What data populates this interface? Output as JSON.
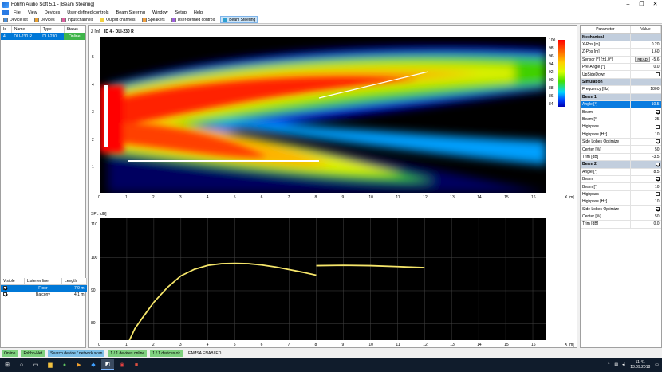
{
  "window": {
    "title": "Fohhn Audio Soft 5.1 - [Beam Steering]",
    "controls": [
      "–",
      "❐",
      "✕"
    ]
  },
  "menu": [
    "File",
    "View",
    "Devices",
    "User-defined controls",
    "Beam Steering",
    "Window",
    "Setup",
    "Help"
  ],
  "tabs": [
    {
      "label": "Device list",
      "color": "#4a8fd8"
    },
    {
      "label": "Devices",
      "color": "#e8a030"
    },
    {
      "label": "Input channels",
      "color": "#e060a0"
    },
    {
      "label": "Output channels",
      "color": "#f0d040"
    },
    {
      "label": "Speakers",
      "color": "#f0a040"
    },
    {
      "label": "User-defined controls",
      "color": "#a060e0"
    },
    {
      "label": "Beam Steering",
      "color": "#30a0d0"
    }
  ],
  "device_table": {
    "headers": [
      "Id",
      "Name",
      "Type",
      "Status"
    ],
    "rows": [
      {
        "id": "4",
        "name": "DLI-230 R",
        "type": "DLI-230",
        "status": "Online"
      }
    ]
  },
  "listener_table": {
    "headers": [
      "Visible",
      "Listener line",
      "Length"
    ],
    "rows": [
      {
        "visible": true,
        "name": "Floor",
        "length": "7.9 m"
      },
      {
        "visible": true,
        "name": "Balcony",
        "length": "4.1 m"
      }
    ]
  },
  "top_plot": {
    "ylabel": "Z [m]",
    "device_label": "ID 4 - DLI-230 R",
    "xlabel": "X [m]",
    "xticks": [
      "0",
      "1",
      "2",
      "3",
      "4",
      "5",
      "6",
      "7",
      "8",
      "9",
      "10",
      "11",
      "12",
      "13",
      "14",
      "15",
      "16"
    ],
    "yticks": [
      "5",
      "4",
      "3",
      "2",
      "1"
    ],
    "colorbar_ticks": [
      "100",
      "98",
      "96",
      "94",
      "92",
      "90",
      "88",
      "86",
      "84"
    ]
  },
  "bottom_plot": {
    "ylabel": "SPL [dB]",
    "xlabel": "X [m]",
    "xticks": [
      "0",
      "1",
      "2",
      "3",
      "4",
      "5",
      "6",
      "7",
      "8",
      "9",
      "10",
      "11",
      "12",
      "13",
      "14",
      "15",
      "16"
    ],
    "yticks": [
      "110",
      "100",
      "90",
      "80"
    ]
  },
  "chart_data": {
    "type": "line",
    "title": "",
    "xlabel": "X [m]",
    "ylabel": "SPL [dB]",
    "xlim": [
      0,
      16.5
    ],
    "ylim": [
      75,
      112
    ],
    "series": [
      {
        "name": "Floor",
        "x": [
          1.1,
          1.3,
          1.6,
          2.0,
          2.5,
          3.0,
          3.5,
          4.0,
          4.5,
          5.0,
          5.5,
          6.0,
          6.5,
          7.0,
          7.5,
          8.0
        ],
        "y": [
          75.0,
          78.5,
          82.0,
          86.5,
          91.0,
          94.5,
          96.5,
          97.7,
          98.2,
          98.3,
          98.2,
          97.8,
          97.2,
          96.4,
          95.6,
          94.7
        ]
      },
      {
        "name": "Balcony",
        "x": [
          8.0,
          9.0,
          10.0,
          11.0,
          12.0
        ],
        "y": [
          97.6,
          97.7,
          97.6,
          97.3,
          97.0
        ]
      }
    ]
  },
  "params": {
    "headers": [
      "Parameter",
      "Value"
    ],
    "rows": [
      {
        "type": "sec",
        "name": "Mechanical"
      },
      {
        "name": "X-Pos [m]",
        "value": "0.20"
      },
      {
        "name": "Z-Pos [m]",
        "value": "1.60"
      },
      {
        "name": "Sensor [°] (±1.0°)",
        "value": "-5.6",
        "button": "READ"
      },
      {
        "name": "Pre-Angle [°]",
        "value": "0.0"
      },
      {
        "name": "UpSideDown",
        "check": false
      },
      {
        "type": "sec",
        "name": "Simulation"
      },
      {
        "name": "Frequency [Hz]",
        "value": "1800"
      },
      {
        "type": "sec",
        "name": "Beam 1"
      },
      {
        "name": "Angle [°]",
        "value": "-10.5",
        "hl": true
      },
      {
        "name": "Beam",
        "check": true
      },
      {
        "name": "Beam [°]",
        "value": "25"
      },
      {
        "name": "Highpass",
        "check": false
      },
      {
        "name": "Highpass [Hz]",
        "value": "10"
      },
      {
        "name": "Side Lobes Optimize",
        "check": true
      },
      {
        "name": "Center [%]",
        "value": "50"
      },
      {
        "name": "Trim [dB]",
        "value": "-3.5"
      },
      {
        "type": "sec",
        "name": "Beam 2",
        "check": true
      },
      {
        "name": "Angle [°]",
        "value": "8.5"
      },
      {
        "name": "Beam",
        "check": true
      },
      {
        "name": "Beam [°]",
        "value": "10"
      },
      {
        "name": "Highpass",
        "check": false
      },
      {
        "name": "Highpass [Hz]",
        "value": "10"
      },
      {
        "name": "Side Lobes Optimize",
        "check": true
      },
      {
        "name": "Center [%]",
        "value": "50"
      },
      {
        "name": "Trim [dB]",
        "value": "0.0"
      }
    ]
  },
  "status": [
    {
      "label": "Online",
      "color": "g"
    },
    {
      "label": "Fohhn-Net",
      "color": "g"
    },
    {
      "label": "Search device / network scan",
      "color": "b"
    },
    {
      "label": "1 / 1 devices online",
      "color": "g"
    },
    {
      "label": "1 / 1 devices ok",
      "color": "g"
    },
    {
      "label": "FAMSA ENABLED",
      "color": ""
    }
  ],
  "taskbar": {
    "time": "11:41",
    "date": "13.09.2018"
  }
}
